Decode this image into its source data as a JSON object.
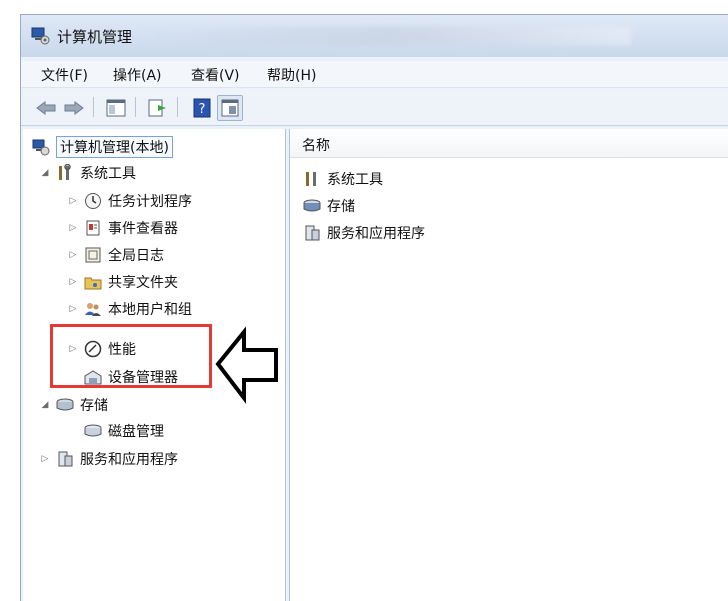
{
  "window": {
    "title": "计算机管理"
  },
  "menu": [
    {
      "label": "文件(F)"
    },
    {
      "label": "操作(A)"
    },
    {
      "label": "查看(V)"
    },
    {
      "label": "帮助(H)"
    }
  ],
  "toolbar": {
    "buttons": [
      "back-icon",
      "forward-icon",
      "show-hide-tree-icon",
      "export-list-icon",
      "help-icon",
      "properties-icon"
    ]
  },
  "tree": {
    "root": "计算机管理(本地)",
    "system_tools": "系统工具",
    "task_scheduler": "任务计划程序",
    "event_viewer": "事件查看器",
    "shared_folders": "全局日志",
    "shared_folders2": "共享文件夹",
    "local_users": "本地用户和组",
    "performance": "性能",
    "device_manager": "设备管理器",
    "storage": "存储",
    "disk_management": "磁盘管理",
    "services_apps": "服务和应用程序"
  },
  "right": {
    "column_name": "名称",
    "items": [
      "系统工具",
      "存储",
      "服务和应用程序"
    ]
  },
  "colors": {
    "highlight": "#e53935",
    "window_bg": "#eaf1fb"
  }
}
